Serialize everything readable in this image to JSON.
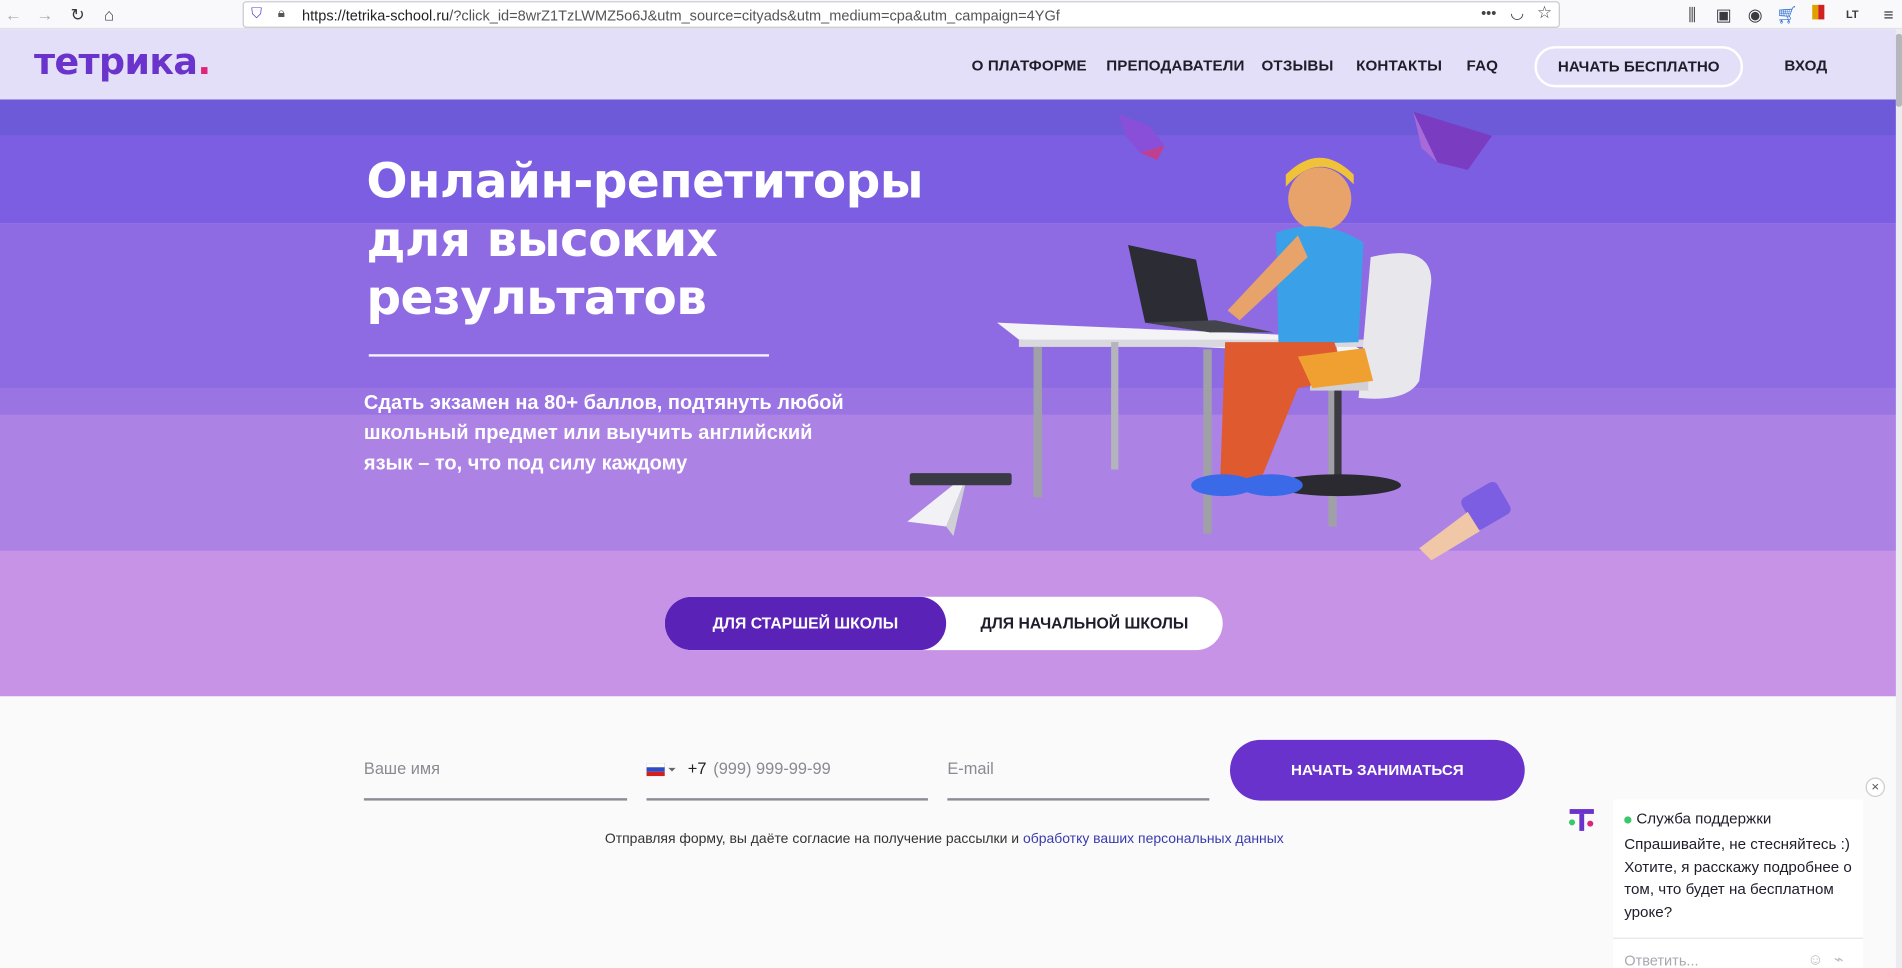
{
  "browser": {
    "url_host": "https://tetrika-school.ru",
    "url_rest": "/?click_id=8wrZ1TzLWMZ5o6J&utm_source=cityads&utm_medium=cpa&utm_campaign=4YGf"
  },
  "header": {
    "logo_main": "тетрика",
    "logo_dot": ".",
    "nav": [
      "О ПЛАТФОРМЕ",
      "ПРЕПОДАВАТЕЛИ",
      "ОТЗЫВЫ",
      "КОНТАКТЫ",
      "FAQ"
    ],
    "cta": "НАЧАТЬ БЕСПЛАТНО",
    "login": "ВХОД"
  },
  "hero": {
    "title": "Онлайн-репетиторы для высоких результатов",
    "subtitle": "Сдать экзамен на 80+ баллов, подтянуть любой школьный предмет или выучить английский язык – то, что под силу каждому"
  },
  "toggles": {
    "senior": "ДЛЯ СТАРШЕЙ ШКОЛЫ",
    "junior": "ДЛЯ НАЧАЛЬНОЙ ШКОЛЫ"
  },
  "form": {
    "name_placeholder": "Ваше имя",
    "phone_code": "+7",
    "phone_placeholder": "(999) 999-99-99",
    "email_placeholder": "E-mail",
    "submit": "НАЧАТЬ ЗАНИМАТЬСЯ",
    "consent_text": "Отправляя форму, вы даёте согласие на получение рассылки и ",
    "consent_link": "обработку ваших персональных данных"
  },
  "chat": {
    "title": "Служба поддержки",
    "message": "Спрашивайте, не стесняйтесь :) Хотите, я расскажу подробнее о том, что будет на бесплатном уроке?",
    "input_placeholder": "Ответить...",
    "close": "×"
  },
  "colors": {
    "brand": "#6a33cc",
    "header_bg": "#e4dff8",
    "hero_bg": "#c693e6",
    "button": "#5b22b8"
  },
  "icons": [
    "back-icon",
    "forward-icon",
    "reload-icon",
    "home-icon",
    "shield-icon",
    "lock-icon",
    "more-icon",
    "pocket-icon",
    "star-icon",
    "library-icon",
    "sidebar-icon",
    "account-icon",
    "cart-icon",
    "flag-icon",
    "lt-icon",
    "menu-icon",
    "russia-flag-icon",
    "close-icon",
    "emoji-icon",
    "attach-icon"
  ]
}
